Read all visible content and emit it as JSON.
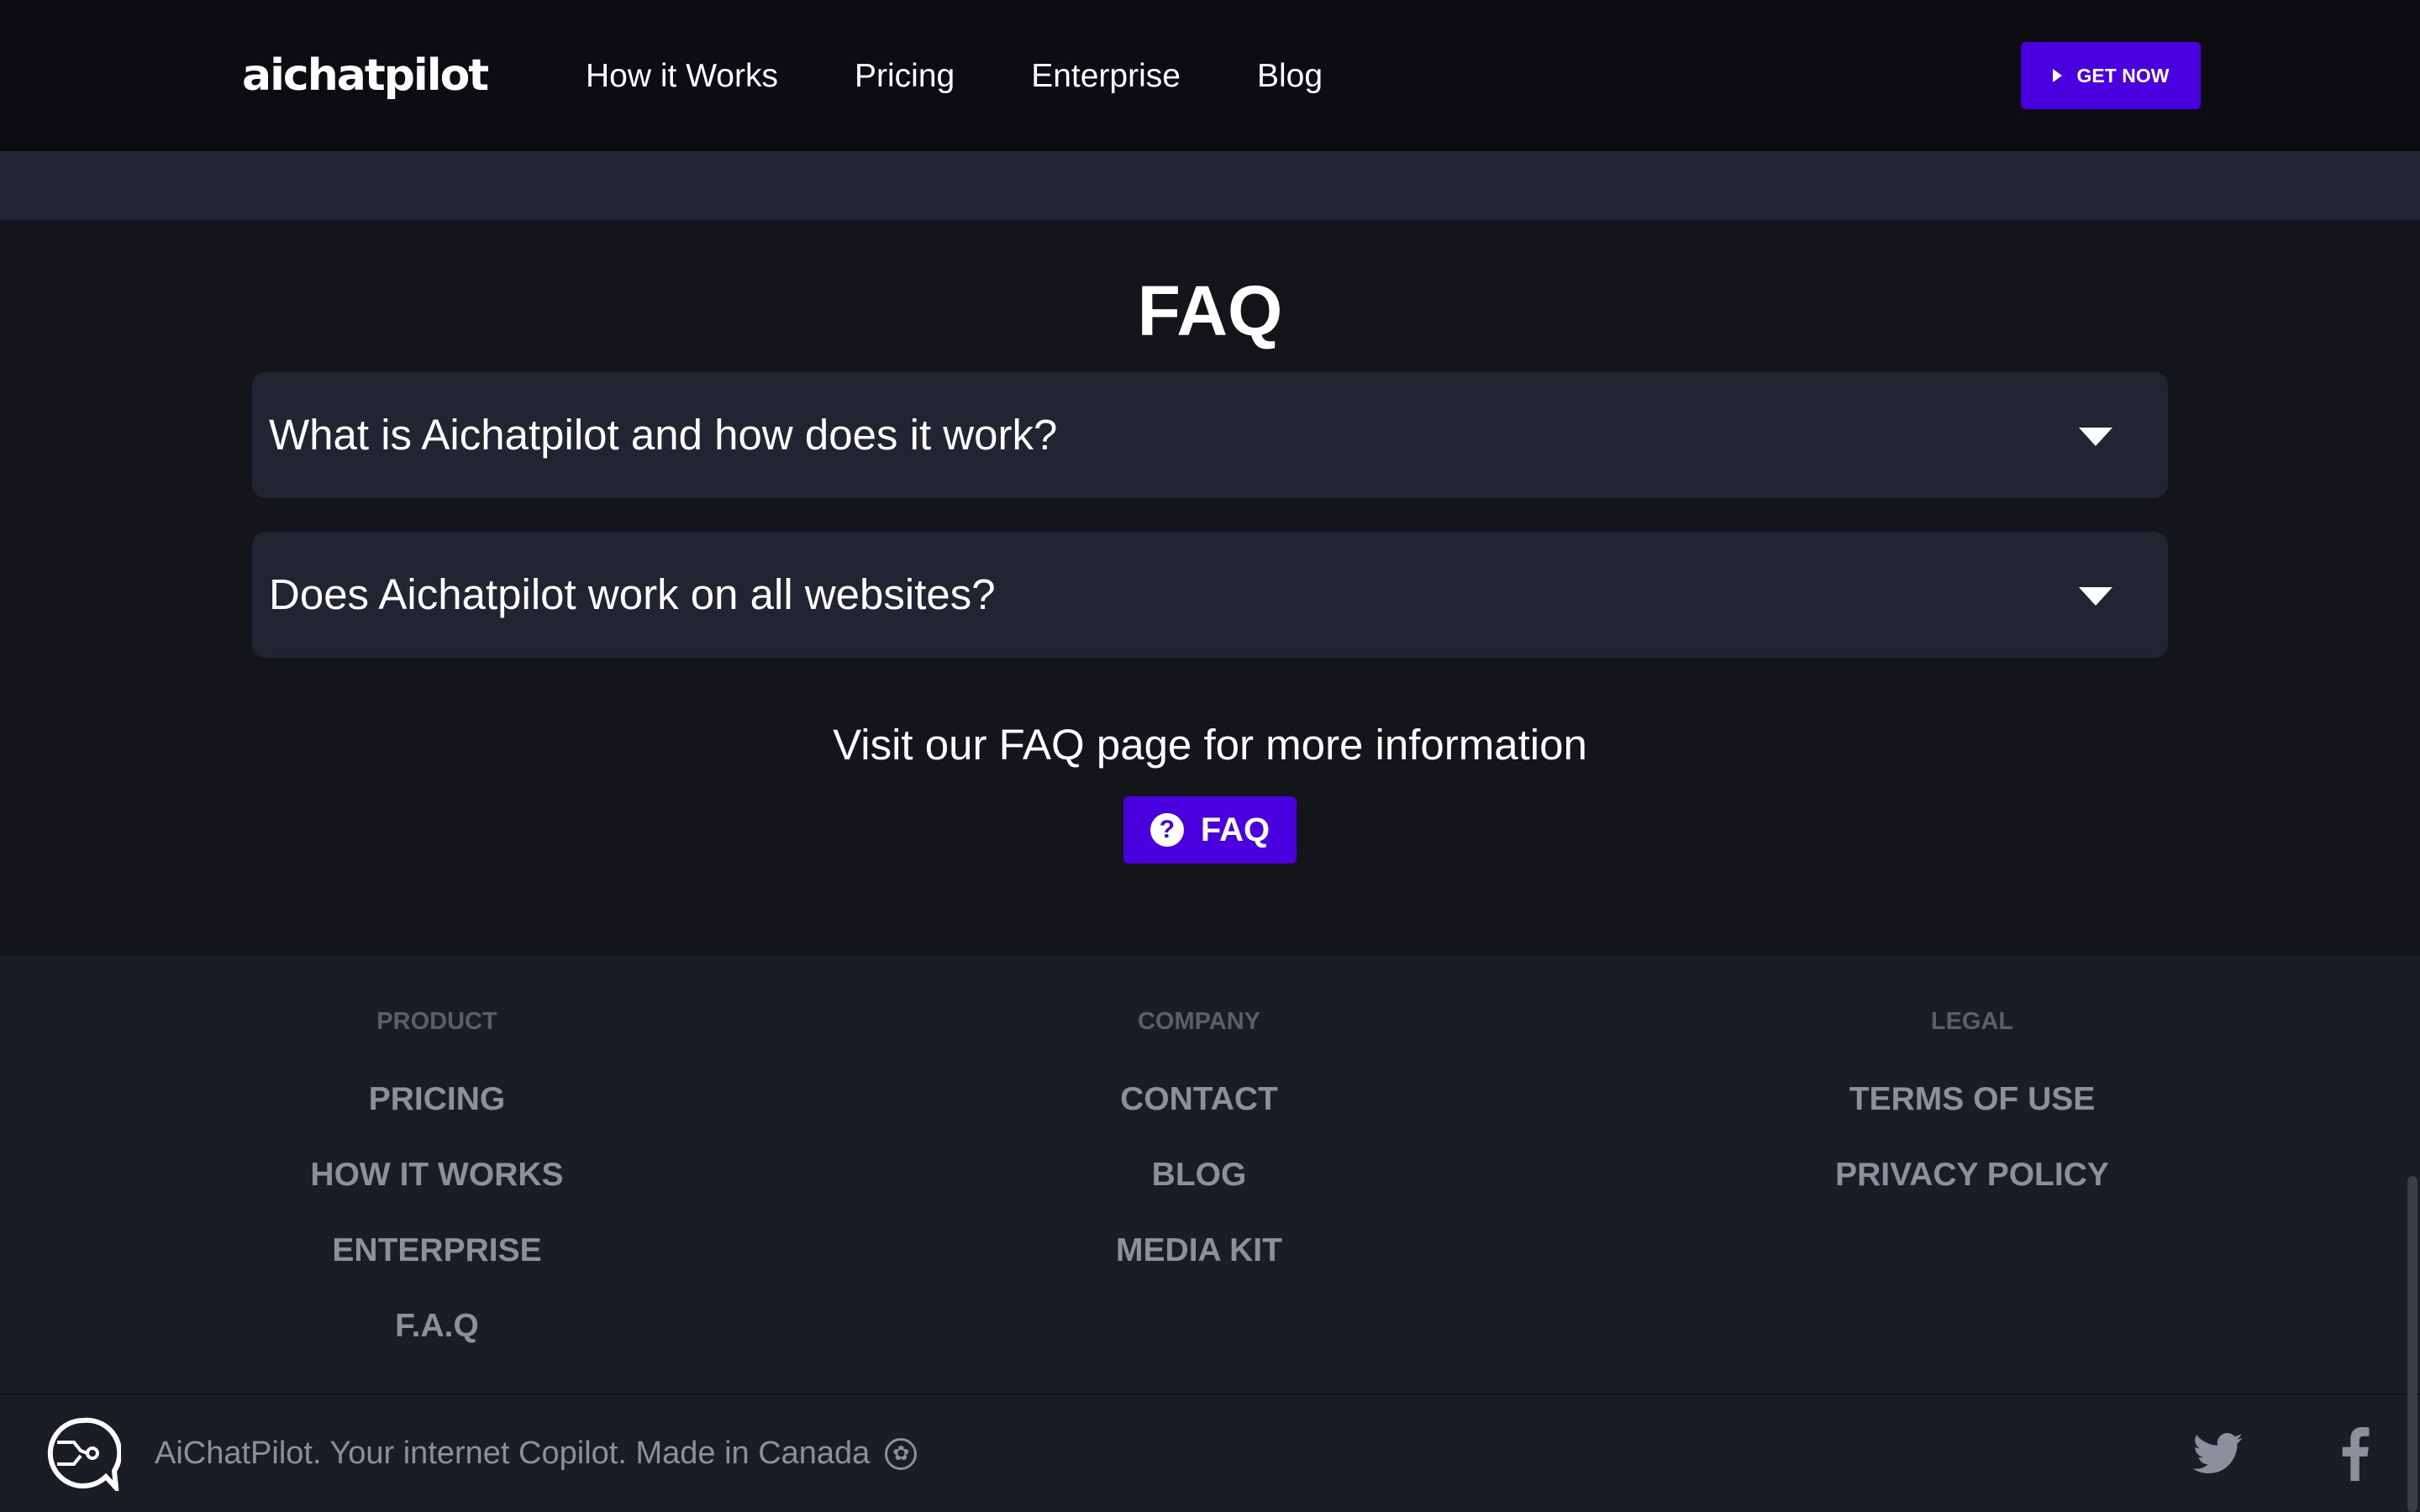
{
  "header": {
    "logo": "aichatpilot",
    "nav": [
      "How it Works",
      "Pricing",
      "Enterprise",
      "Blog"
    ],
    "cta": "GET NOW"
  },
  "faq": {
    "title": "FAQ",
    "items": [
      "What is Aichatpilot and how does it work?",
      "Does Aichatpilot work on all websites?"
    ],
    "more_text": "Visit our FAQ page for more information",
    "button_label": "FAQ",
    "help_glyph": "?"
  },
  "footer": {
    "columns": [
      {
        "heading": "PRODUCT",
        "links": [
          "PRICING",
          "HOW IT WORKS",
          "ENTERPRISE",
          "F.A.Q"
        ]
      },
      {
        "heading": "COMPANY",
        "links": [
          "CONTACT",
          "BLOG",
          "MEDIA KIT"
        ]
      },
      {
        "heading": "LEGAL",
        "links": [
          "TERMS OF USE",
          "PRIVACY POLICY"
        ]
      }
    ],
    "tagline": "AiChatPilot. Your internet Copilot. Made in Canada",
    "icons": [
      "brand-chat-icon",
      "maple-leaf-icon",
      "twitter-icon",
      "facebook-icon"
    ]
  },
  "colors": {
    "accent": "#4b00e0",
    "background": "#14151b",
    "panel": "#212431",
    "muted": "#8c8f9c"
  }
}
